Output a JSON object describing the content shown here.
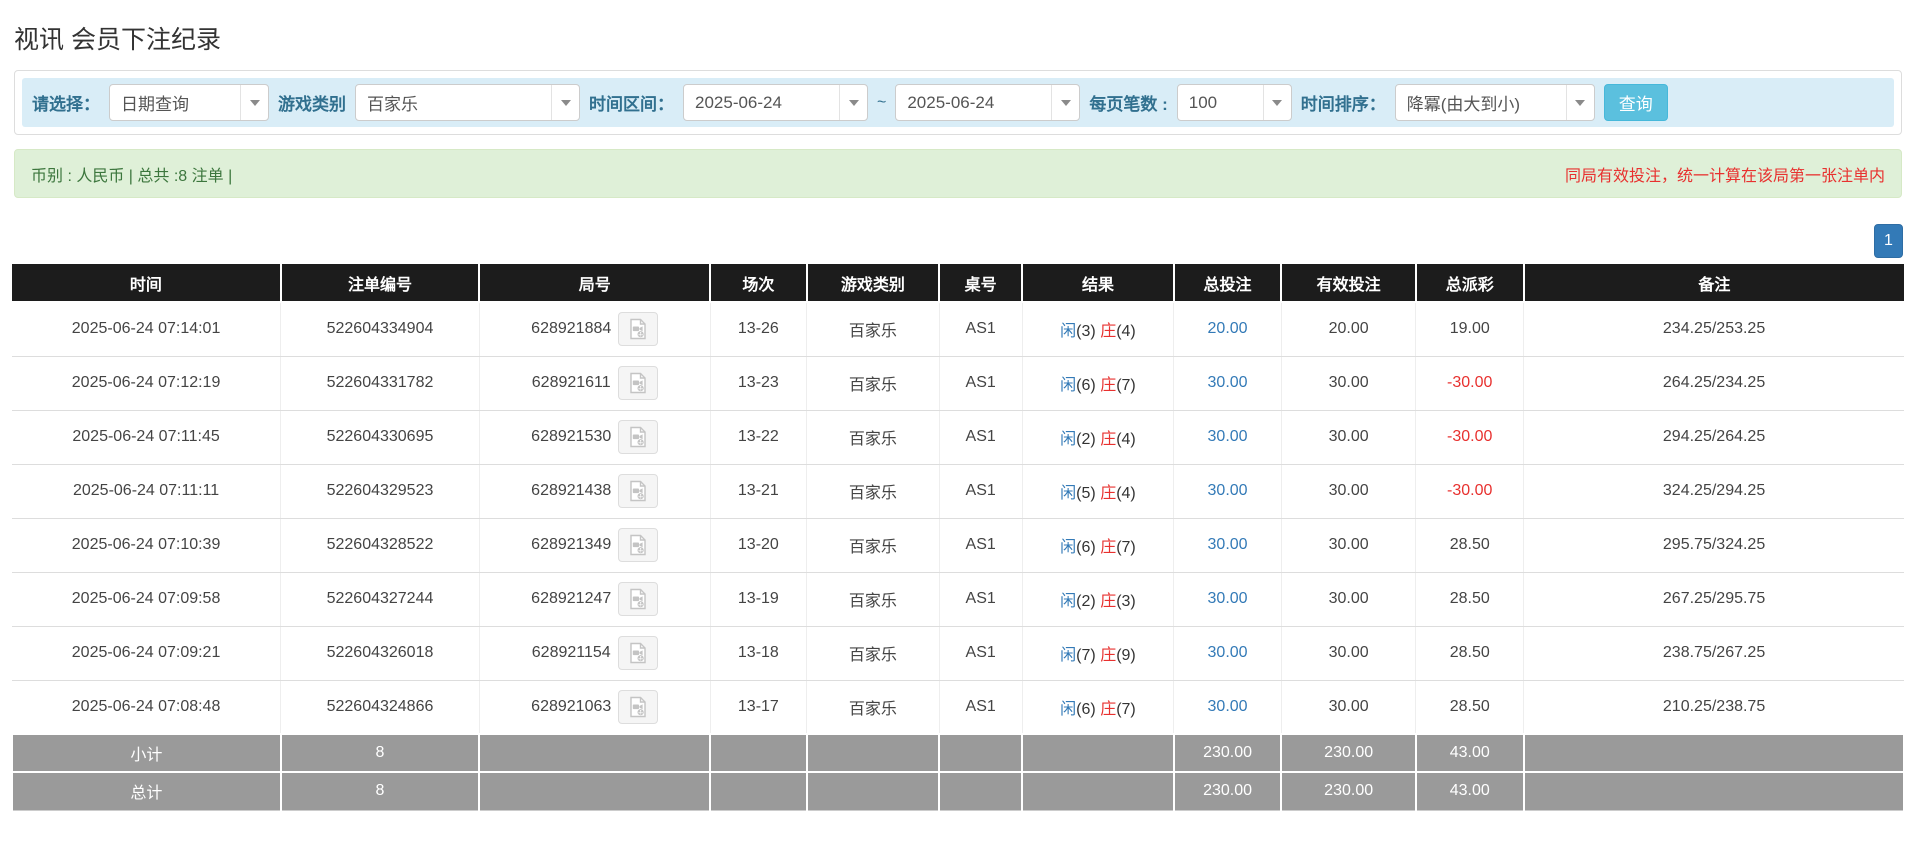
{
  "page": {
    "title": "视讯 会员下注纪录"
  },
  "filters": {
    "select_label": "请选择：",
    "query_type_value": "日期查询",
    "game_type_label": "游戏类别",
    "game_type_value": "百家乐",
    "date_range_label": "时间区间：",
    "date_from": "2025-06-24",
    "range_separator": "~",
    "date_to": "2025-06-24",
    "page_size_label": "每页笔数 :",
    "page_size_value": "100",
    "sort_label": "时间排序：",
    "sort_value": "降冪(由大到小)",
    "search_button_label": "查询"
  },
  "summary": {
    "left_text": "币别 : 人民币 | 总共 :8 注单 |",
    "right_notice": "同局有效投注，统一计算在该局第一张注单内"
  },
  "pagination": {
    "current_page": "1"
  },
  "table": {
    "headers": [
      "时间",
      "注单编号",
      "局号",
      "场次",
      "游戏类别",
      "桌号",
      "结果",
      "总投注",
      "有效投注",
      "总派彩",
      "备注"
    ],
    "rows": [
      {
        "time": "2025-06-24 07:14:01",
        "bet_no": "522604334904",
        "round_no": "628921884",
        "session": "13-26",
        "game": "百家乐",
        "table_no": "AS1",
        "result_player": "闲",
        "result_player_score": "(3)",
        "result_banker": "庄",
        "result_banker_score": "(4)",
        "total_bet": "20.00",
        "valid_bet": "20.00",
        "payout": "19.00",
        "remark": "234.25/253.25"
      },
      {
        "time": "2025-06-24 07:12:19",
        "bet_no": "522604331782",
        "round_no": "628921611",
        "session": "13-23",
        "game": "百家乐",
        "table_no": "AS1",
        "result_player": "闲",
        "result_player_score": "(6)",
        "result_banker": "庄",
        "result_banker_score": "(7)",
        "total_bet": "30.00",
        "valid_bet": "30.00",
        "payout": "-30.00",
        "remark": "264.25/234.25"
      },
      {
        "time": "2025-06-24 07:11:45",
        "bet_no": "522604330695",
        "round_no": "628921530",
        "session": "13-22",
        "game": "百家乐",
        "table_no": "AS1",
        "result_player": "闲",
        "result_player_score": "(2)",
        "result_banker": "庄",
        "result_banker_score": "(4)",
        "total_bet": "30.00",
        "valid_bet": "30.00",
        "payout": "-30.00",
        "remark": "294.25/264.25"
      },
      {
        "time": "2025-06-24 07:11:11",
        "bet_no": "522604329523",
        "round_no": "628921438",
        "session": "13-21",
        "game": "百家乐",
        "table_no": "AS1",
        "result_player": "闲",
        "result_player_score": "(5)",
        "result_banker": "庄",
        "result_banker_score": "(4)",
        "total_bet": "30.00",
        "valid_bet": "30.00",
        "payout": "-30.00",
        "remark": "324.25/294.25"
      },
      {
        "time": "2025-06-24 07:10:39",
        "bet_no": "522604328522",
        "round_no": "628921349",
        "session": "13-20",
        "game": "百家乐",
        "table_no": "AS1",
        "result_player": "闲",
        "result_player_score": "(6)",
        "result_banker": "庄",
        "result_banker_score": "(7)",
        "total_bet": "30.00",
        "valid_bet": "30.00",
        "payout": "28.50",
        "remark": "295.75/324.25"
      },
      {
        "time": "2025-06-24 07:09:58",
        "bet_no": "522604327244",
        "round_no": "628921247",
        "session": "13-19",
        "game": "百家乐",
        "table_no": "AS1",
        "result_player": "闲",
        "result_player_score": "(2)",
        "result_banker": "庄",
        "result_banker_score": "(3)",
        "total_bet": "30.00",
        "valid_bet": "30.00",
        "payout": "28.50",
        "remark": "267.25/295.75"
      },
      {
        "time": "2025-06-24 07:09:21",
        "bet_no": "522604326018",
        "round_no": "628921154",
        "session": "13-18",
        "game": "百家乐",
        "table_no": "AS1",
        "result_player": "闲",
        "result_player_score": "(7)",
        "result_banker": "庄",
        "result_banker_score": "(9)",
        "total_bet": "30.00",
        "valid_bet": "30.00",
        "payout": "28.50",
        "remark": "238.75/267.25"
      },
      {
        "time": "2025-06-24 07:08:48",
        "bet_no": "522604324866",
        "round_no": "628921063",
        "session": "13-17",
        "game": "百家乐",
        "table_no": "AS1",
        "result_player": "闲",
        "result_player_score": "(6)",
        "result_banker": "庄",
        "result_banker_score": "(7)",
        "total_bet": "30.00",
        "valid_bet": "30.00",
        "payout": "28.50",
        "remark": "210.25/238.75"
      }
    ],
    "subtotal": {
      "label": "小计",
      "count": "8",
      "total_bet": "230.00",
      "valid_bet": "230.00",
      "payout": "43.00"
    },
    "total": {
      "label": "总计",
      "count": "8",
      "total_bet": "230.00",
      "valid_bet": "230.00",
      "payout": "43.00"
    }
  },
  "colors": {
    "filter_bar_bg": "#d9edf7",
    "filter_label_text": "#31708f",
    "search_button_bg": "#5bc0de",
    "summary_bg": "#dff0d8",
    "summary_text": "#3c763d",
    "notice_red": "#e8312f",
    "table_header_bg": "#1c1c1c",
    "footer_row_bg": "#9a9a9a",
    "link_blue": "#337ab7",
    "player_blue": "#337ab7",
    "banker_red": "#e8312f",
    "pagination_bg": "#337ab7"
  }
}
